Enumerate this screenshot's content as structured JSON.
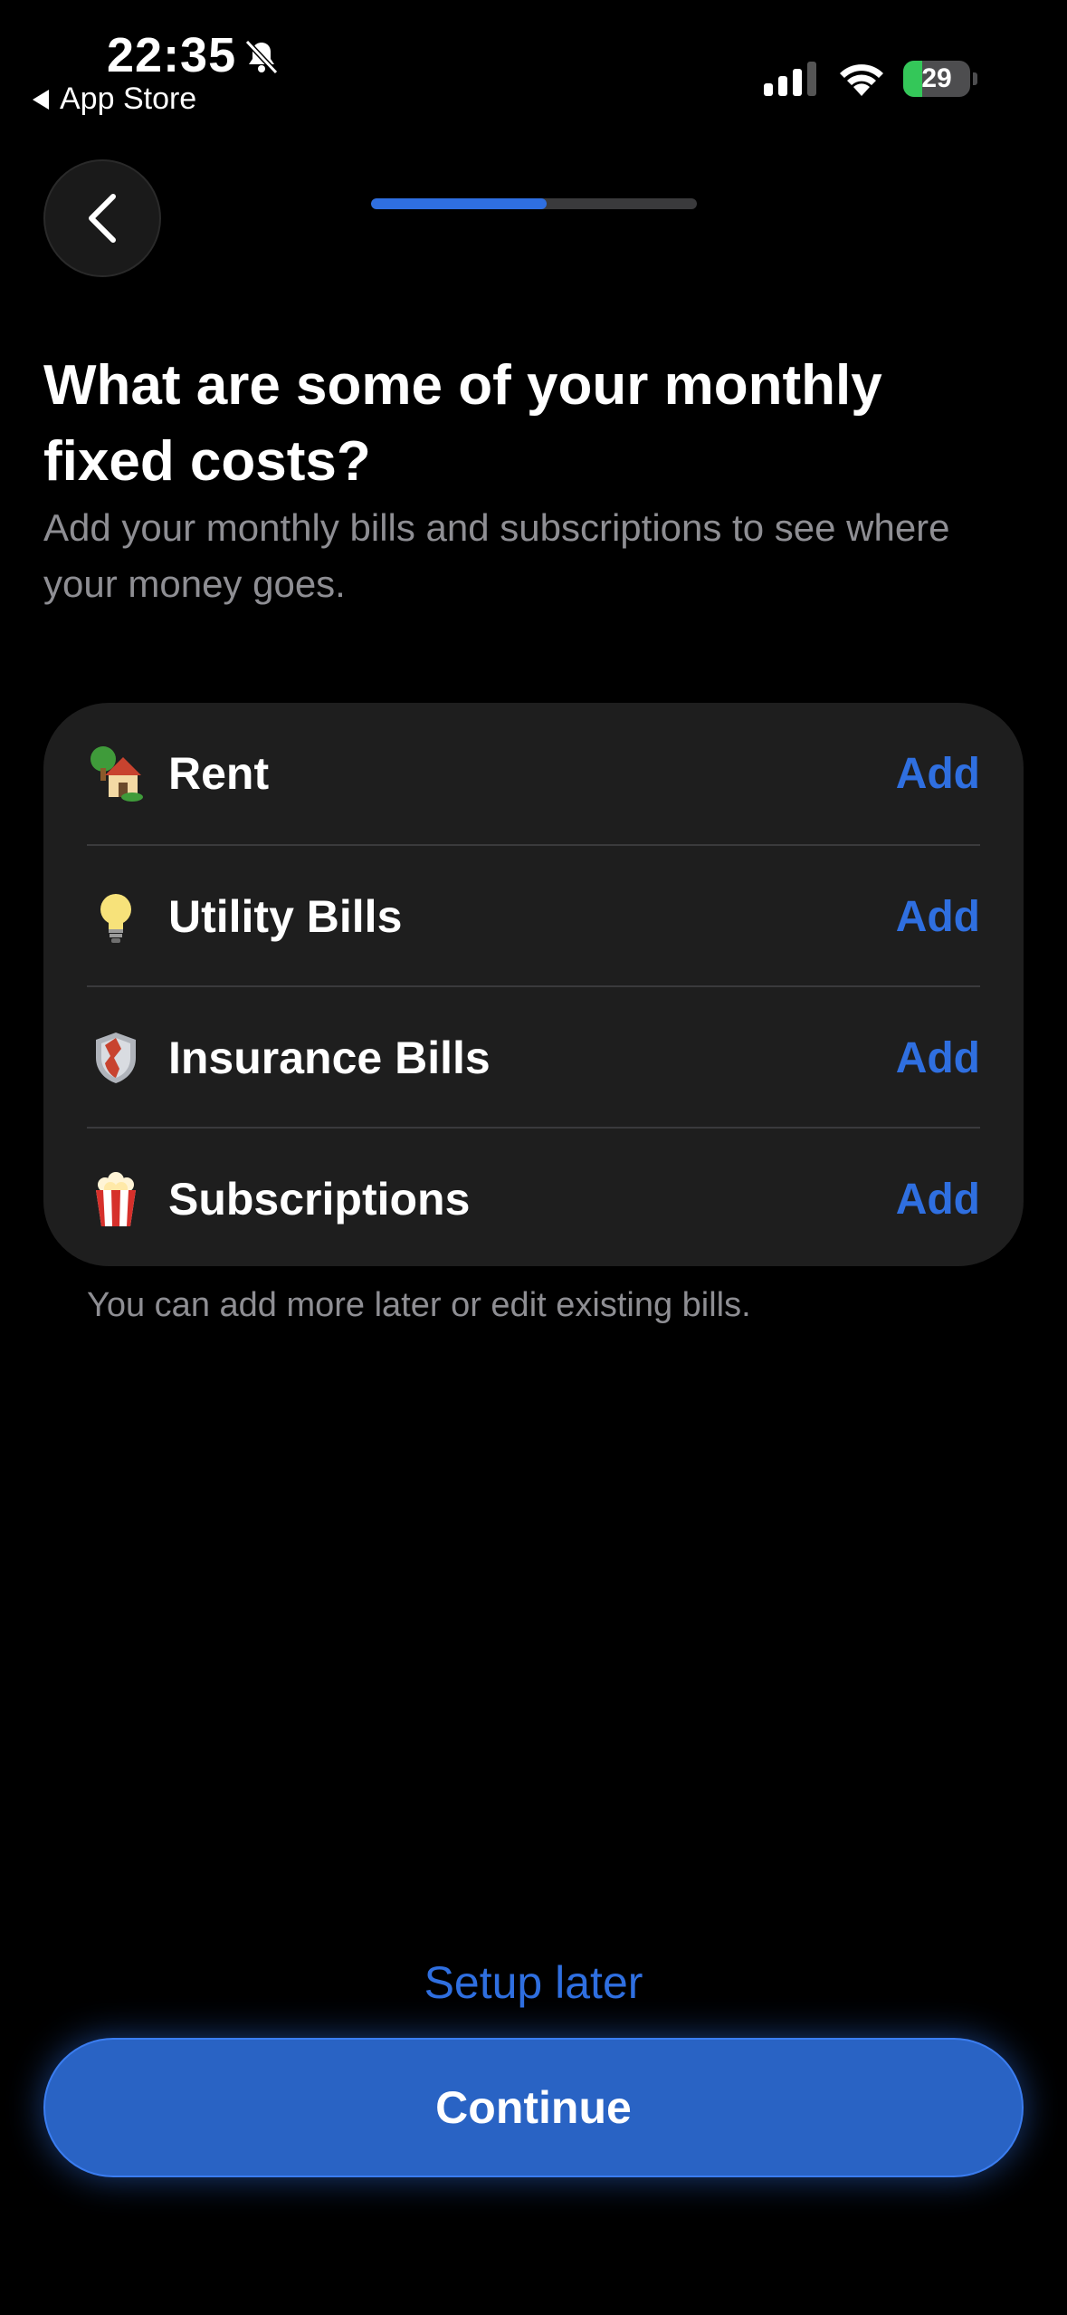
{
  "status_bar": {
    "time": "22:35",
    "back_app": "App Store",
    "battery_level": "29",
    "battery_fraction": 0.29,
    "signal_bars_active": 3,
    "signal_bars_total": 4
  },
  "header": {
    "progress_fraction": 0.54
  },
  "title": "What are some of your monthly fixed costs?",
  "subtitle": "Add your monthly bills and subscriptions to see where your money goes.",
  "bills": [
    {
      "label": "Rent",
      "icon": "house-with-garden-icon",
      "action": "Add"
    },
    {
      "label": "Utility Bills",
      "icon": "light-bulb-icon",
      "action": "Add"
    },
    {
      "label": "Insurance Bills",
      "icon": "shield-icon",
      "action": "Add"
    },
    {
      "label": "Subscriptions",
      "icon": "popcorn-icon",
      "action": "Add"
    }
  ],
  "hint": "You can add more later or edit existing bills.",
  "setup_later": "Setup later",
  "continue_label": "Continue",
  "colors": {
    "accent": "#2f6fe0",
    "button": "#2963c4",
    "card": "#1e1e1e",
    "muted_text": "#8e8e93",
    "battery_green": "#34c759"
  }
}
